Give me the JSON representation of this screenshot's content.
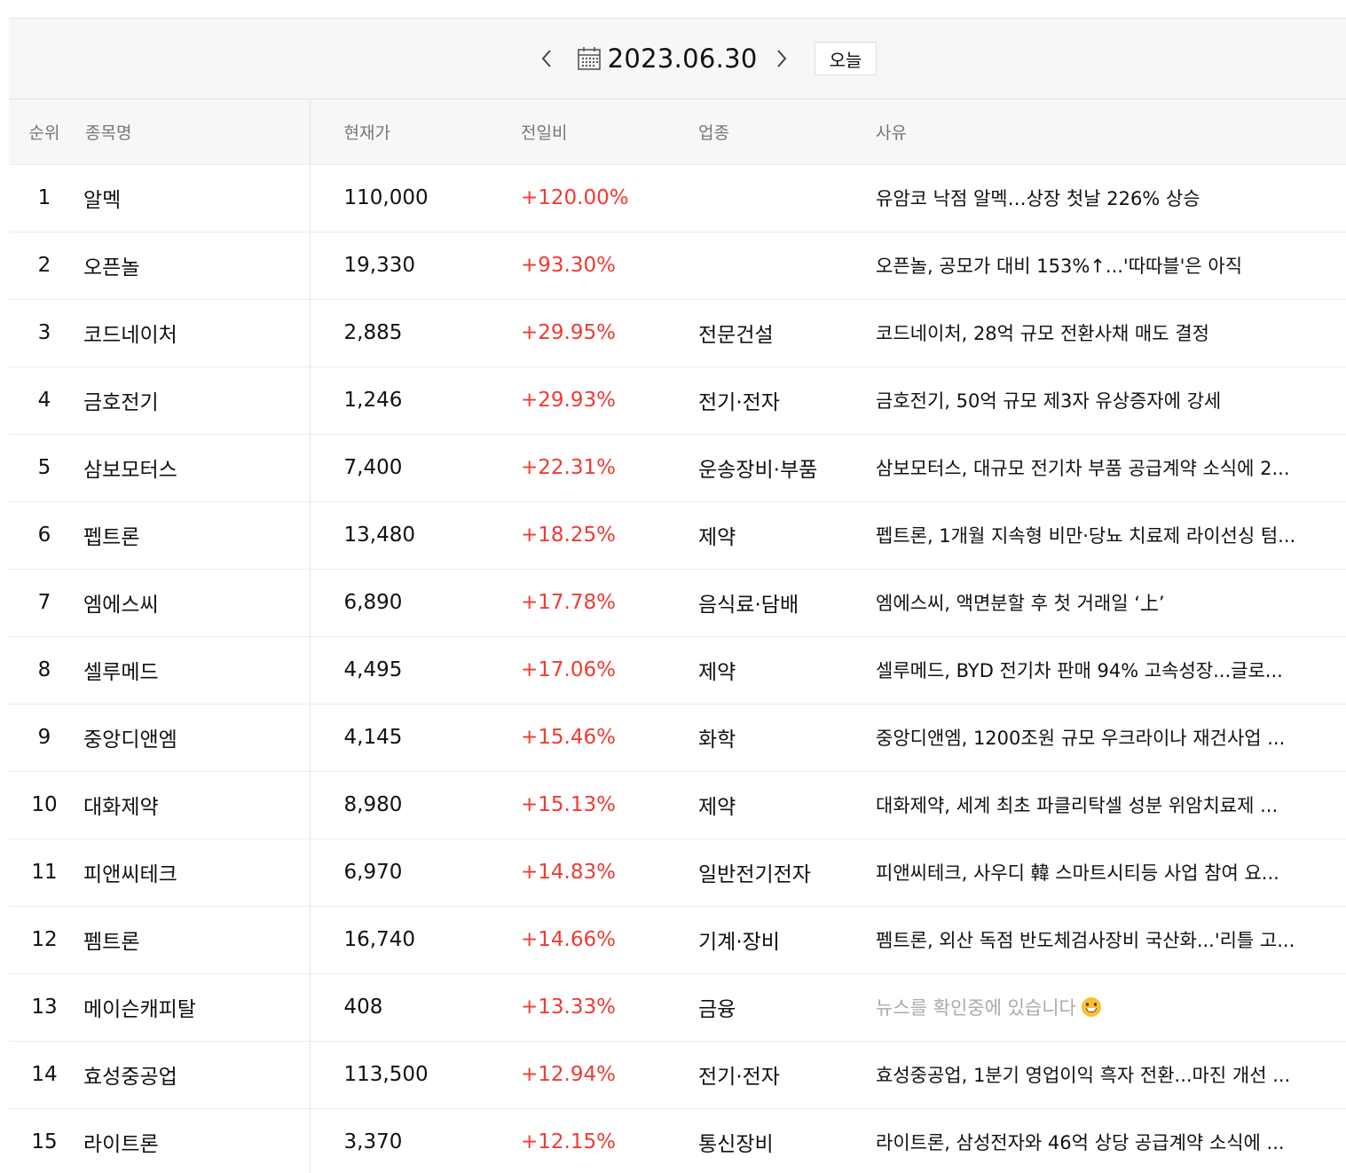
{
  "datebar": {
    "date": "2023.06.30",
    "today_label": "오늘"
  },
  "table": {
    "headers": {
      "rank": "순위",
      "name": "종목명",
      "price": "현재가",
      "change": "전일비",
      "sector": "업종",
      "reason": "사유"
    },
    "rows": [
      {
        "rank": "1",
        "name": "알멕",
        "price": "110,000",
        "change": "+120.00%",
        "sector": "",
        "reason": "유암코 낙점 알멕…상장 첫날 226% 상승"
      },
      {
        "rank": "2",
        "name": "오픈놀",
        "price": "19,330",
        "change": "+93.30%",
        "sector": "",
        "reason": "오픈놀, 공모가 대비 153%↑...'따따블'은 아직"
      },
      {
        "rank": "3",
        "name": "코드네이처",
        "price": "2,885",
        "change": "+29.95%",
        "sector": "전문건설",
        "reason": "코드네이처, 28억 규모 전환사채 매도 결정"
      },
      {
        "rank": "4",
        "name": "금호전기",
        "price": "1,246",
        "change": "+29.93%",
        "sector": "전기·전자",
        "reason": "금호전기, 50억 규모 제3자 유상증자에 강세"
      },
      {
        "rank": "5",
        "name": "삼보모터스",
        "price": "7,400",
        "change": "+22.31%",
        "sector": "운송장비·부품",
        "reason": "삼보모터스, 대규모 전기차 부품 공급계약 소식에 2..."
      },
      {
        "rank": "6",
        "name": "펩트론",
        "price": "13,480",
        "change": "+18.25%",
        "sector": "제약",
        "reason": "펩트론, 1개월 지속형 비만·당뇨 치료제 라이선싱 텀..."
      },
      {
        "rank": "7",
        "name": "엠에스씨",
        "price": "6,890",
        "change": "+17.78%",
        "sector": "음식료·담배",
        "reason": "엠에스씨, 액면분할 후 첫 거래일 ‘上’"
      },
      {
        "rank": "8",
        "name": "셀루메드",
        "price": "4,495",
        "change": "+17.06%",
        "sector": "제약",
        "reason": "셀루메드, BYD 전기차 판매 94% 고속성장...글로..."
      },
      {
        "rank": "9",
        "name": "중앙디앤엠",
        "price": "4,145",
        "change": "+15.46%",
        "sector": "화학",
        "reason": "중앙디앤엠, 1200조원 규모 우크라이나 재건사업 ..."
      },
      {
        "rank": "10",
        "name": "대화제약",
        "price": "8,980",
        "change": "+15.13%",
        "sector": "제약",
        "reason": "대화제약, 세계 최초 파클리탁셀 성분 위암치료제 ..."
      },
      {
        "rank": "11",
        "name": "피앤씨테크",
        "price": "6,970",
        "change": "+14.83%",
        "sector": "일반전기전자",
        "reason": "피앤씨테크, 사우디 韓 스마트시티등 사업 참여 요..."
      },
      {
        "rank": "12",
        "name": "펨트론",
        "price": "16,740",
        "change": "+14.66%",
        "sector": "기계·장비",
        "reason": "펨트론, 외산 독점 반도체검사장비 국산화...'리틀 고..."
      },
      {
        "rank": "13",
        "name": "메이슨캐피탈",
        "price": "408",
        "change": "+13.33%",
        "sector": "금융",
        "reason": "뉴스를 확인중에 있습니다",
        "reason_pending": true
      },
      {
        "rank": "14",
        "name": "효성중공업",
        "price": "113,500",
        "change": "+12.94%",
        "sector": "전기·전자",
        "reason": "효성중공업, 1분기 영업이익 흑자 전환...마진 개선 ..."
      },
      {
        "rank": "15",
        "name": "라이트론",
        "price": "3,370",
        "change": "+12.15%",
        "sector": "통신장비",
        "reason": "라이트론, 삼성전자와 46억 상당 공급계약 소식에 ..."
      }
    ]
  },
  "colors": {
    "up": "#ee3b33",
    "header_bg": "#f7f7f7",
    "muted": "#aaaaaa"
  },
  "icons": {
    "prev": "chevron-left-icon",
    "next": "chevron-right-icon",
    "calendar": "calendar-icon",
    "pending": "grinning-face-icon"
  }
}
